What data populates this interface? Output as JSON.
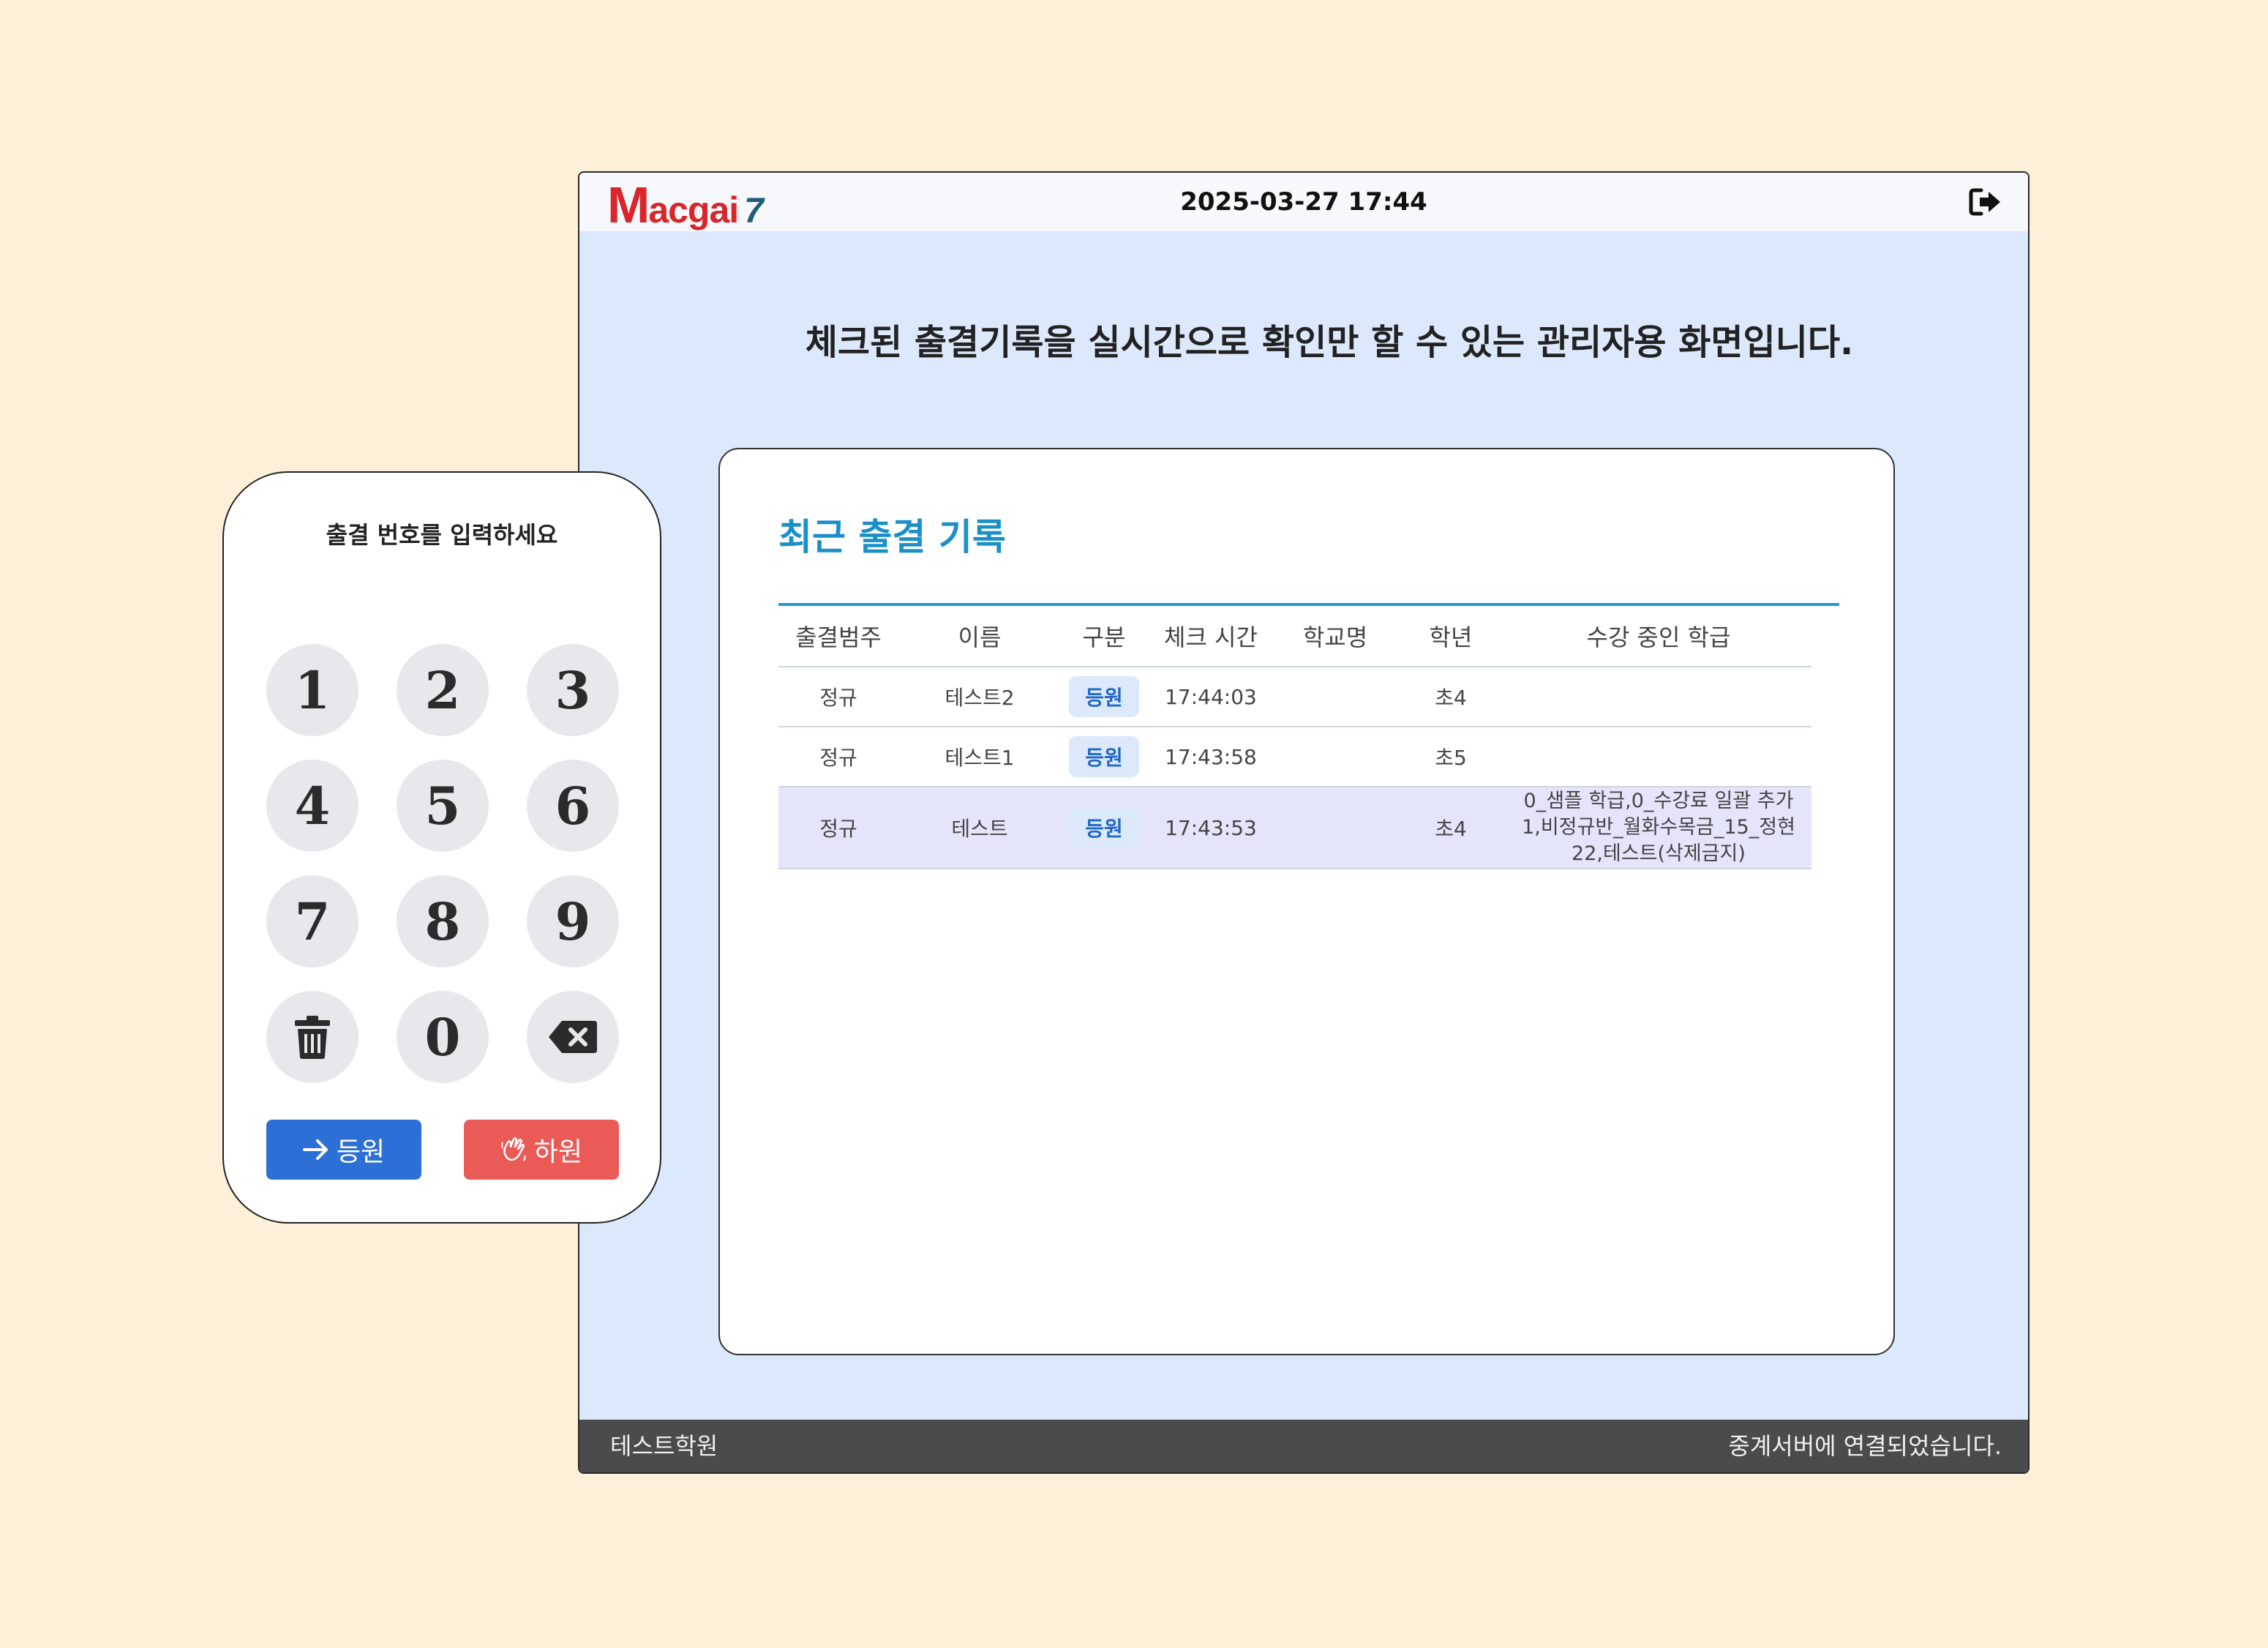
{
  "window": {
    "logo": {
      "m": "M",
      "rest": "acgai",
      "seven": "7"
    },
    "datetime": "2025-03-27 17:44",
    "logout_icon": "logout-icon",
    "headline": "체크된 출결기록을 실시간으로 확인만 할 수 있는 관리자용 화면입니다.",
    "card": {
      "title": "최근 출결 기록",
      "columns": [
        "출결범주",
        "이름",
        "구분",
        "체크 시간",
        "학교명",
        "학년",
        "수강 중인 학급"
      ],
      "rows": [
        {
          "category": "정규",
          "name": "테스트2",
          "type": "등원",
          "time": "17:44:03",
          "school": "",
          "grade": "초4",
          "classes": []
        },
        {
          "category": "정규",
          "name": "테스트1",
          "type": "등원",
          "time": "17:43:58",
          "school": "",
          "grade": "초5",
          "classes": []
        },
        {
          "category": "정규",
          "name": "테스트",
          "type": "등원",
          "time": "17:43:53",
          "school": "",
          "grade": "초4",
          "classes": [
            "0_샘플 학급,0_수강료 일괄 추가",
            "1,비정규반_월화수목금_15_정현",
            "22,테스트(삭제금지)"
          ]
        }
      ]
    },
    "footer": {
      "academy": "테스트학원",
      "status": "중계서버에 연결되었습니다."
    }
  },
  "keypad": {
    "title": "출결 번호를 입력하세요",
    "keys": [
      "1",
      "2",
      "3",
      "4",
      "5",
      "6",
      "7",
      "8",
      "9",
      "",
      "0",
      ""
    ],
    "checkin_label": "등원",
    "checkout_label": "하원",
    "colors": {
      "checkin": "#2c6fd6",
      "checkout": "#ea5a57"
    }
  },
  "colors": {
    "background": "#fcf0d9",
    "window_bg": "#dce9fc",
    "accent": "#1a8fc8",
    "selected_row": "#e4e4fb"
  }
}
